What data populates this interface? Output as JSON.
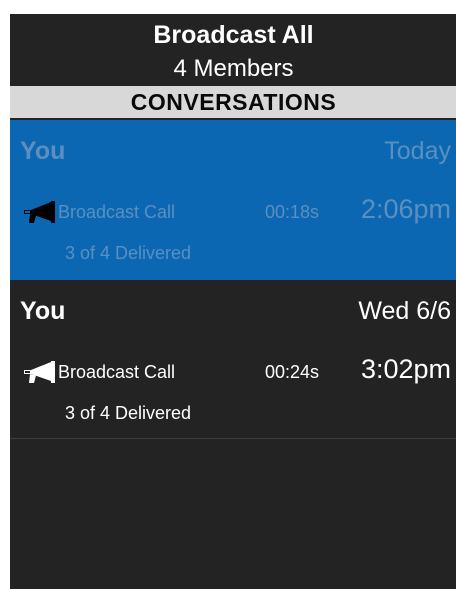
{
  "header": {
    "title": "Broadcast All",
    "subtitle": "4 Members"
  },
  "section": {
    "label": "CONVERSATIONS"
  },
  "conversations": [
    {
      "sender": "You",
      "date": "Today",
      "icon": "megaphone-icon",
      "call_type": "Broadcast Call",
      "duration": "00:18s",
      "time": "2:06pm",
      "delivery": "3 of 4 Delivered",
      "selected": true
    },
    {
      "sender": "You",
      "date": "Wed 6/6",
      "icon": "megaphone-icon",
      "call_type": "Broadcast Call",
      "duration": "00:24s",
      "time": "3:02pm",
      "delivery": "3 of 4 Delivered",
      "selected": false
    }
  ],
  "colors": {
    "background": "#232323",
    "selected_row": "#0b67b1",
    "selected_text": "#5b8fc0",
    "section_bar": "#d8d8d8",
    "text": "#ffffff"
  }
}
